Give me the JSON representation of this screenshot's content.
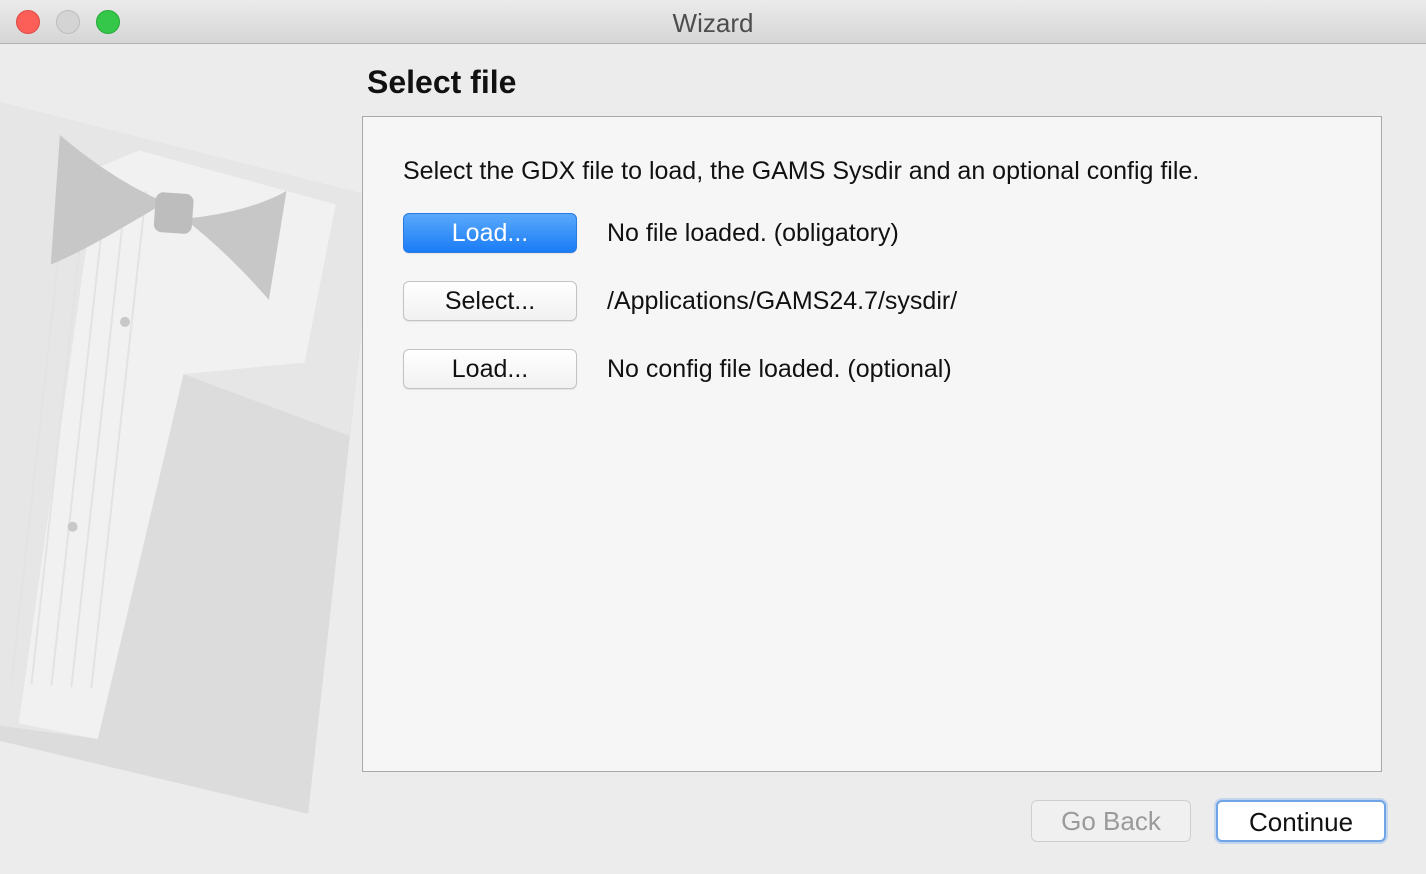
{
  "window": {
    "title": "Wizard",
    "controls": [
      "close-button",
      "minimize-button",
      "zoom-button"
    ]
  },
  "page": {
    "title": "Select file",
    "instructions": "Select the GDX file to load, the GAMS Sysdir and an optional config file."
  },
  "rows": [
    {
      "button_label": "Load...",
      "status": "No file loaded. (obligatory)",
      "primary": true
    },
    {
      "button_label": "Select...",
      "status": "/Applications/GAMS24.7/sysdir/",
      "primary": false
    },
    {
      "button_label": "Load...",
      "status": "No config file loaded. (optional)",
      "primary": false
    }
  ],
  "footer": {
    "back_label": "Go Back",
    "back_enabled": false,
    "continue_label": "Continue"
  },
  "colors": {
    "primary_button": "#1a7cf6",
    "close": "#fc5f57",
    "zoom": "#34c749"
  },
  "icons": [
    "tuxedo-watermark-icon"
  ]
}
